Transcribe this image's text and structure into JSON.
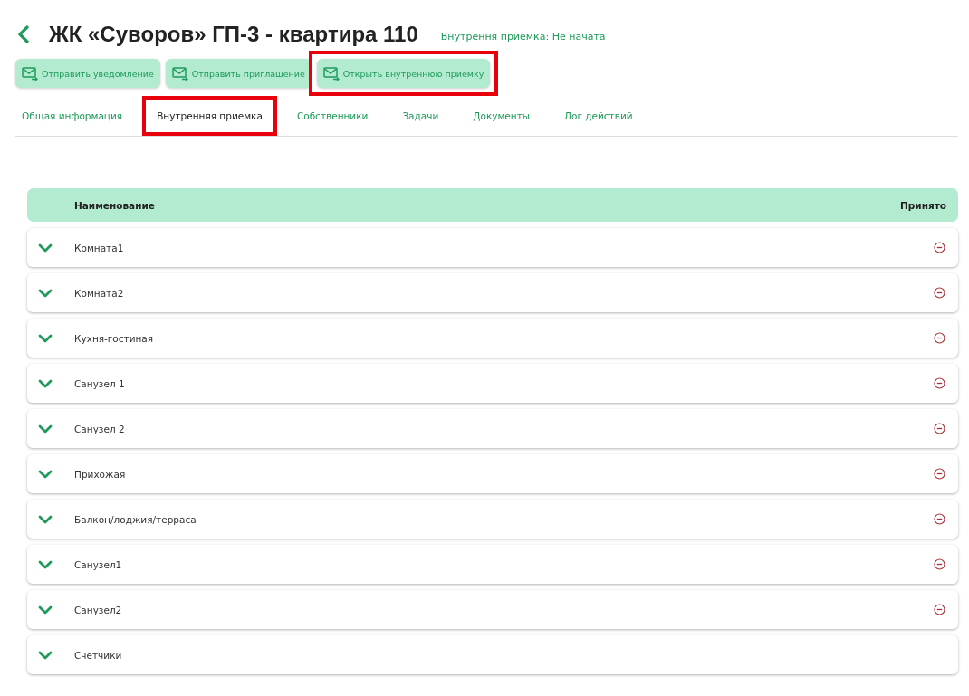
{
  "header": {
    "title": "ЖК «Суворов» ГП-3 - квартира 110",
    "status": "Внутрення приемка: Не начата"
  },
  "actions": [
    {
      "label": "Отправить уведомление",
      "highlighted": false
    },
    {
      "label": "Отправить приглашение",
      "highlighted": false
    },
    {
      "label": "Открыть внутреннюю приемку",
      "highlighted": true
    }
  ],
  "tabs": [
    {
      "label": "Общая информация",
      "selected": false,
      "highlighted": false
    },
    {
      "label": "Внутренняя приемка",
      "selected": true,
      "highlighted": true
    },
    {
      "label": "Собственники",
      "selected": false,
      "highlighted": false
    },
    {
      "label": "Задачи",
      "selected": false,
      "highlighted": false
    },
    {
      "label": "Документы",
      "selected": false,
      "highlighted": false
    },
    {
      "label": "Лог действий",
      "selected": false,
      "highlighted": false
    }
  ],
  "table": {
    "columns": [
      "Наименование",
      "Принято"
    ],
    "rows": [
      {
        "name": "Комната1",
        "rejected": true
      },
      {
        "name": "Комната2",
        "rejected": true
      },
      {
        "name": "Кухня-гостиная",
        "rejected": true
      },
      {
        "name": "Санузел 1",
        "rejected": true
      },
      {
        "name": "Санузел 2",
        "rejected": true
      },
      {
        "name": "Прихожая",
        "rejected": true
      },
      {
        "name": "Балкон/лоджия/терраса",
        "rejected": true
      },
      {
        "name": "Санузел1",
        "rejected": true
      },
      {
        "name": "Санузел2",
        "rejected": true
      },
      {
        "name": "Счетчики",
        "rejected": false
      }
    ]
  }
}
